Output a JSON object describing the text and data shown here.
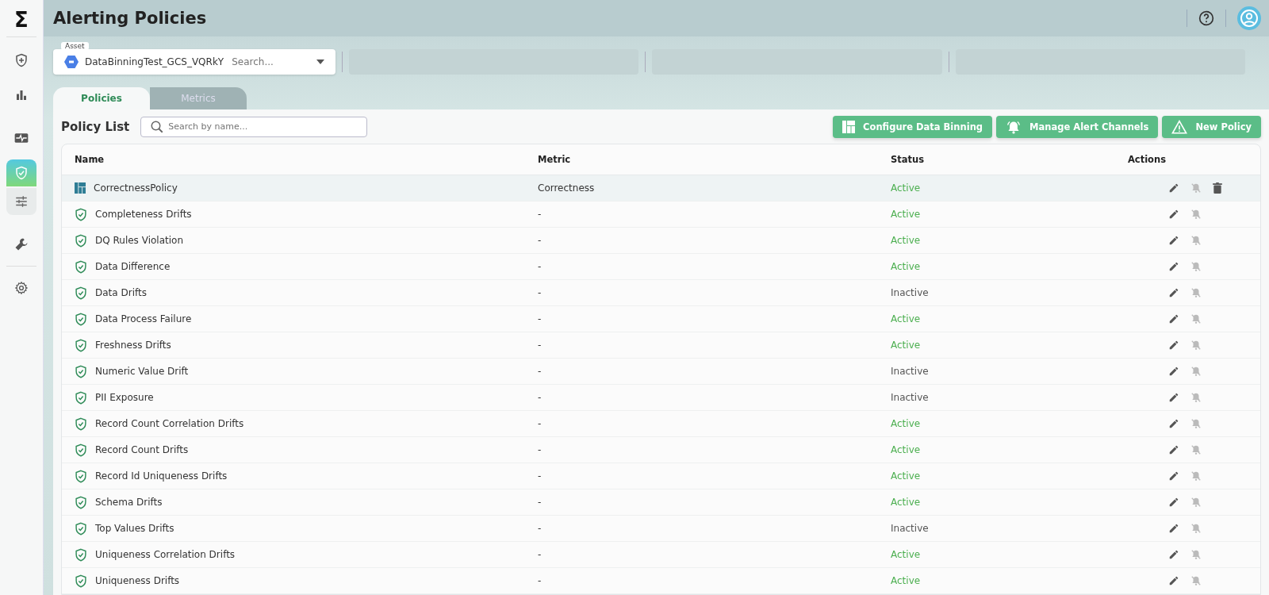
{
  "sidebar": {
    "logo": "Σ",
    "items": [
      {
        "kind": "shield-plus",
        "selected": false
      },
      {
        "kind": "bars",
        "selected": false
      },
      {
        "kind": "pulse",
        "selected": false
      },
      {
        "kind": "shield-check",
        "selected": true
      },
      {
        "kind": "sliders",
        "selected": false
      },
      {
        "kind": "wrench",
        "selected": false
      },
      {
        "kind": "gear",
        "selected": false
      }
    ]
  },
  "header": {
    "title": "Alerting Policies"
  },
  "asset": {
    "label": "Asset",
    "value": "DataBinningTest_GCS_VQRkY",
    "placeholder": "Search..."
  },
  "tabs": [
    {
      "label": "Policies",
      "selected": true
    },
    {
      "label": "Metrics",
      "selected": false
    }
  ],
  "policy_list": {
    "title": "Policy List",
    "search": {
      "placeholder": "Search by name..."
    },
    "buttons": [
      {
        "kind": "binning",
        "label": "Configure Data Binning"
      },
      {
        "kind": "bell",
        "label": "Manage Alert Channels"
      },
      {
        "kind": "warning",
        "label": "New Policy"
      }
    ],
    "columns": [
      "Name",
      "Metric",
      "Status",
      "Actions"
    ],
    "rows": [
      {
        "kind": "binning",
        "name": "CorrectnessPolicy",
        "metric": "Correctness",
        "status": "Active",
        "active": true,
        "deletable": true,
        "selected": true
      },
      {
        "kind": "shield",
        "name": "Completeness Drifts",
        "metric": "-",
        "status": "Active",
        "active": true,
        "deletable": false,
        "selected": false
      },
      {
        "kind": "shield",
        "name": "DQ Rules Violation",
        "metric": "-",
        "status": "Active",
        "active": true,
        "deletable": false,
        "selected": false
      },
      {
        "kind": "shield",
        "name": "Data Difference",
        "metric": "-",
        "status": "Active",
        "active": true,
        "deletable": false,
        "selected": false
      },
      {
        "kind": "shield",
        "name": "Data Drifts",
        "metric": "-",
        "status": "Inactive",
        "active": false,
        "deletable": false,
        "selected": false
      },
      {
        "kind": "shield",
        "name": "Data Process Failure",
        "metric": "-",
        "status": "Active",
        "active": true,
        "deletable": false,
        "selected": false
      },
      {
        "kind": "shield",
        "name": "Freshness Drifts",
        "metric": "-",
        "status": "Active",
        "active": true,
        "deletable": false,
        "selected": false
      },
      {
        "kind": "shield",
        "name": "Numeric Value Drift",
        "metric": "-",
        "status": "Inactive",
        "active": false,
        "deletable": false,
        "selected": false
      },
      {
        "kind": "shield",
        "name": "PII Exposure",
        "metric": "-",
        "status": "Inactive",
        "active": false,
        "deletable": false,
        "selected": false
      },
      {
        "kind": "shield",
        "name": "Record Count Correlation Drifts",
        "metric": "-",
        "status": "Active",
        "active": true,
        "deletable": false,
        "selected": false
      },
      {
        "kind": "shield",
        "name": "Record Count Drifts",
        "metric": "-",
        "status": "Active",
        "active": true,
        "deletable": false,
        "selected": false
      },
      {
        "kind": "shield",
        "name": "Record Id Uniqueness Drifts",
        "metric": "-",
        "status": "Active",
        "active": true,
        "deletable": false,
        "selected": false
      },
      {
        "kind": "shield",
        "name": "Schema Drifts",
        "metric": "-",
        "status": "Active",
        "active": true,
        "deletable": false,
        "selected": false
      },
      {
        "kind": "shield",
        "name": "Top Values Drifts",
        "metric": "-",
        "status": "Inactive",
        "active": false,
        "deletable": false,
        "selected": false
      },
      {
        "kind": "shield",
        "name": "Uniqueness Correlation Drifts",
        "metric": "-",
        "status": "Active",
        "active": true,
        "deletable": false,
        "selected": false
      },
      {
        "kind": "shield",
        "name": "Uniqueness Drifts",
        "metric": "-",
        "status": "Active",
        "active": true,
        "deletable": false,
        "selected": false
      }
    ]
  }
}
